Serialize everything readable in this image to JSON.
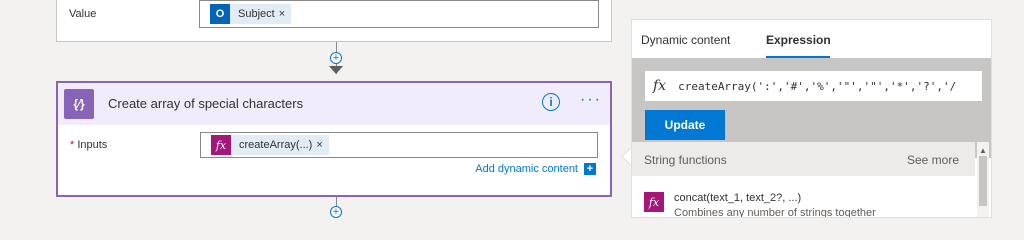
{
  "top_card": {
    "value_label": "Value",
    "token_label": "Subject",
    "token_remove": "×"
  },
  "connector_plus": "+",
  "action_card": {
    "title": "Create array of special characters",
    "icon_glyph": "{⁄}",
    "info_glyph": "i",
    "more_glyph": "···",
    "inputs_required_mark": "*",
    "inputs_label": "Inputs",
    "token_icon_glyph": "fx",
    "token_label": "createArray(...)",
    "token_remove": "×",
    "add_dynamic_label": "Add dynamic content",
    "add_dynamic_glyph": "+"
  },
  "panel": {
    "tabs": [
      {
        "label": "Dynamic content",
        "active": false
      },
      {
        "label": "Expression",
        "active": true
      }
    ],
    "fx_glyph": "fx",
    "expression_value": "createArray(':','#','%','\"','\"','*','?','/",
    "update_label": "Update",
    "section_title": "String functions",
    "see_more_label": "See more",
    "functions": [
      {
        "icon": "fx",
        "name": "concat(text_1, text_2?, ...)",
        "description": "Combines any number of strings together"
      }
    ]
  },
  "icons": {
    "outlook_icon": "O",
    "scroll_up_glyph": "▲"
  },
  "colors": {
    "accent": "#0078d4",
    "action_purple": "#8764b8",
    "function_magenta": "#a4167a"
  }
}
